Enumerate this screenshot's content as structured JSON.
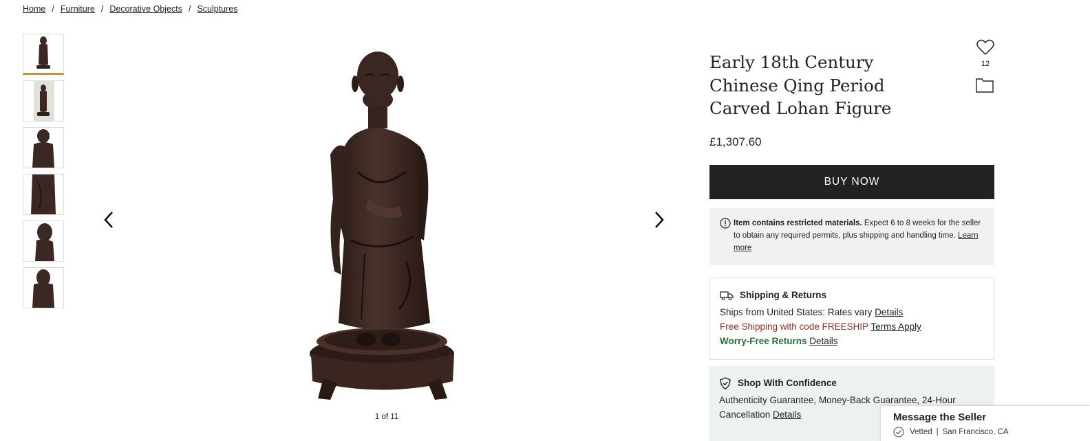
{
  "breadcrumb": {
    "items": [
      "Home",
      "Furniture",
      "Decorative Objects",
      "Sculptures"
    ],
    "separator": "/"
  },
  "gallery": {
    "thumbnail_count": 6,
    "active_thumbnail": 0,
    "counter": "1 of 11",
    "prev_icon": "chevron-left-icon",
    "next_icon": "chevron-right-icon"
  },
  "product": {
    "title": "Early 18th Century Chinese Qing Period Carved Lohan Figure",
    "favorites_count": "12",
    "price": "£1,307.60",
    "buy_label": "BUY NOW"
  },
  "notice": {
    "bold": "Item contains restricted materials.",
    "text": " Expect 6 to 8 weeks for the seller to obtain any required permits, plus shipping and handling time. ",
    "link": "Learn more"
  },
  "shipping": {
    "heading": "Shipping & Returns",
    "line1_text": "Ships from United States: Rates vary ",
    "line1_link": "Details",
    "line2_text": "Free Shipping with code FREESHIP ",
    "line2_link": "Terms Apply",
    "line3_text": "Worry-Free Returns",
    "line3_link": "Details"
  },
  "confidence": {
    "heading": "Shop With Confidence",
    "text": "Authenticity Guarantee, Money-Back Guarantee, 24-Hour Cancellation ",
    "link": "Details"
  },
  "message": {
    "title": "Message the Seller",
    "vetted": "Vetted",
    "separator": "|",
    "location": "San Francisco, CA"
  },
  "colors": {
    "accent_gold": "#b8963f",
    "buy_button": "#222222",
    "promo_red": "#8f2a2a",
    "returns_green": "#2e6b3a",
    "notice_bg": "#f1f1f1",
    "confidence_bg": "#eef1f1"
  }
}
